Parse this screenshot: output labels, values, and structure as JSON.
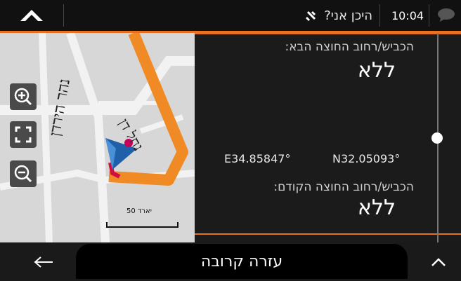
{
  "topbar": {
    "title": "היכן אני?",
    "time": "10:04",
    "icons": [
      "menu-up-icon",
      "satellite-icon",
      "chat-icon"
    ]
  },
  "map": {
    "street_labels": [
      "נהר הירדן",
      "נחל דן"
    ],
    "scale_label": "50 יארד",
    "buttons": [
      "zoom-in-icon",
      "fullscreen-icon",
      "zoom-out-icon"
    ],
    "route_color": "#f08a24"
  },
  "panel": {
    "next_street_header": "הכביש/רחוב החוצה הבא:",
    "next_street_value": "ללא",
    "coordinate_e": "E34.85847°",
    "coordinate_n": "N32.05093°",
    "previous_street_header": "הכביש/רחוב החוצה הקודם:",
    "previous_street_value": "ללא"
  },
  "bottombar": {
    "help_label": "עזרה קרובה"
  },
  "colors": {
    "accent": "#e8711f",
    "panel_bg": "#1b1b1b",
    "topbar_bg": "#111111"
  }
}
